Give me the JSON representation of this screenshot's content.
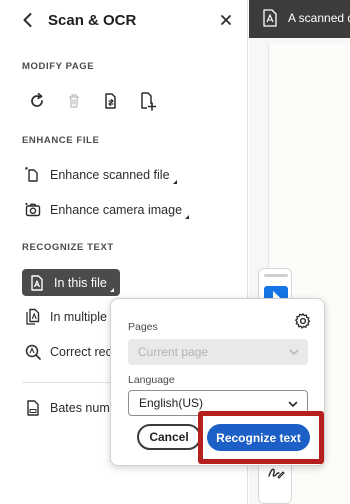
{
  "panel": {
    "title": "Scan & OCR",
    "sections": {
      "modify_page": "MODIFY PAGE",
      "enhance_file": "ENHANCE FILE",
      "recognize_text": "RECOGNIZE TEXT"
    },
    "modify_tools": [
      "rotate-icon",
      "delete-icon",
      "replace-page-icon",
      "insert-page-icon"
    ],
    "enhance_items": [
      {
        "label": "Enhance scanned file",
        "icon": "scan-document-icon"
      },
      {
        "label": "Enhance camera image",
        "icon": "camera-image-icon"
      }
    ],
    "recognize_items": [
      {
        "label": "In this file",
        "icon": "text-file-icon",
        "selected": true
      },
      {
        "label": "In multiple f",
        "icon": "multiple-files-icon"
      },
      {
        "label": "Correct reco",
        "icon": "correct-search-icon"
      }
    ],
    "bates_item": {
      "label": "Bates numb",
      "icon": "bates-icon"
    }
  },
  "document": {
    "tab_label": "A scanned do"
  },
  "popover": {
    "pages_label": "Pages",
    "pages_value": "Current page",
    "language_label": "Language",
    "language_value": "English(US)",
    "cancel_label": "Cancel",
    "primary_label": "Recognize text"
  },
  "colors": {
    "primary": "#1b5fc7",
    "highlight": "#b5201e",
    "selected_item": "#4b4b4b",
    "tab_bar": "#3c3c3c"
  }
}
